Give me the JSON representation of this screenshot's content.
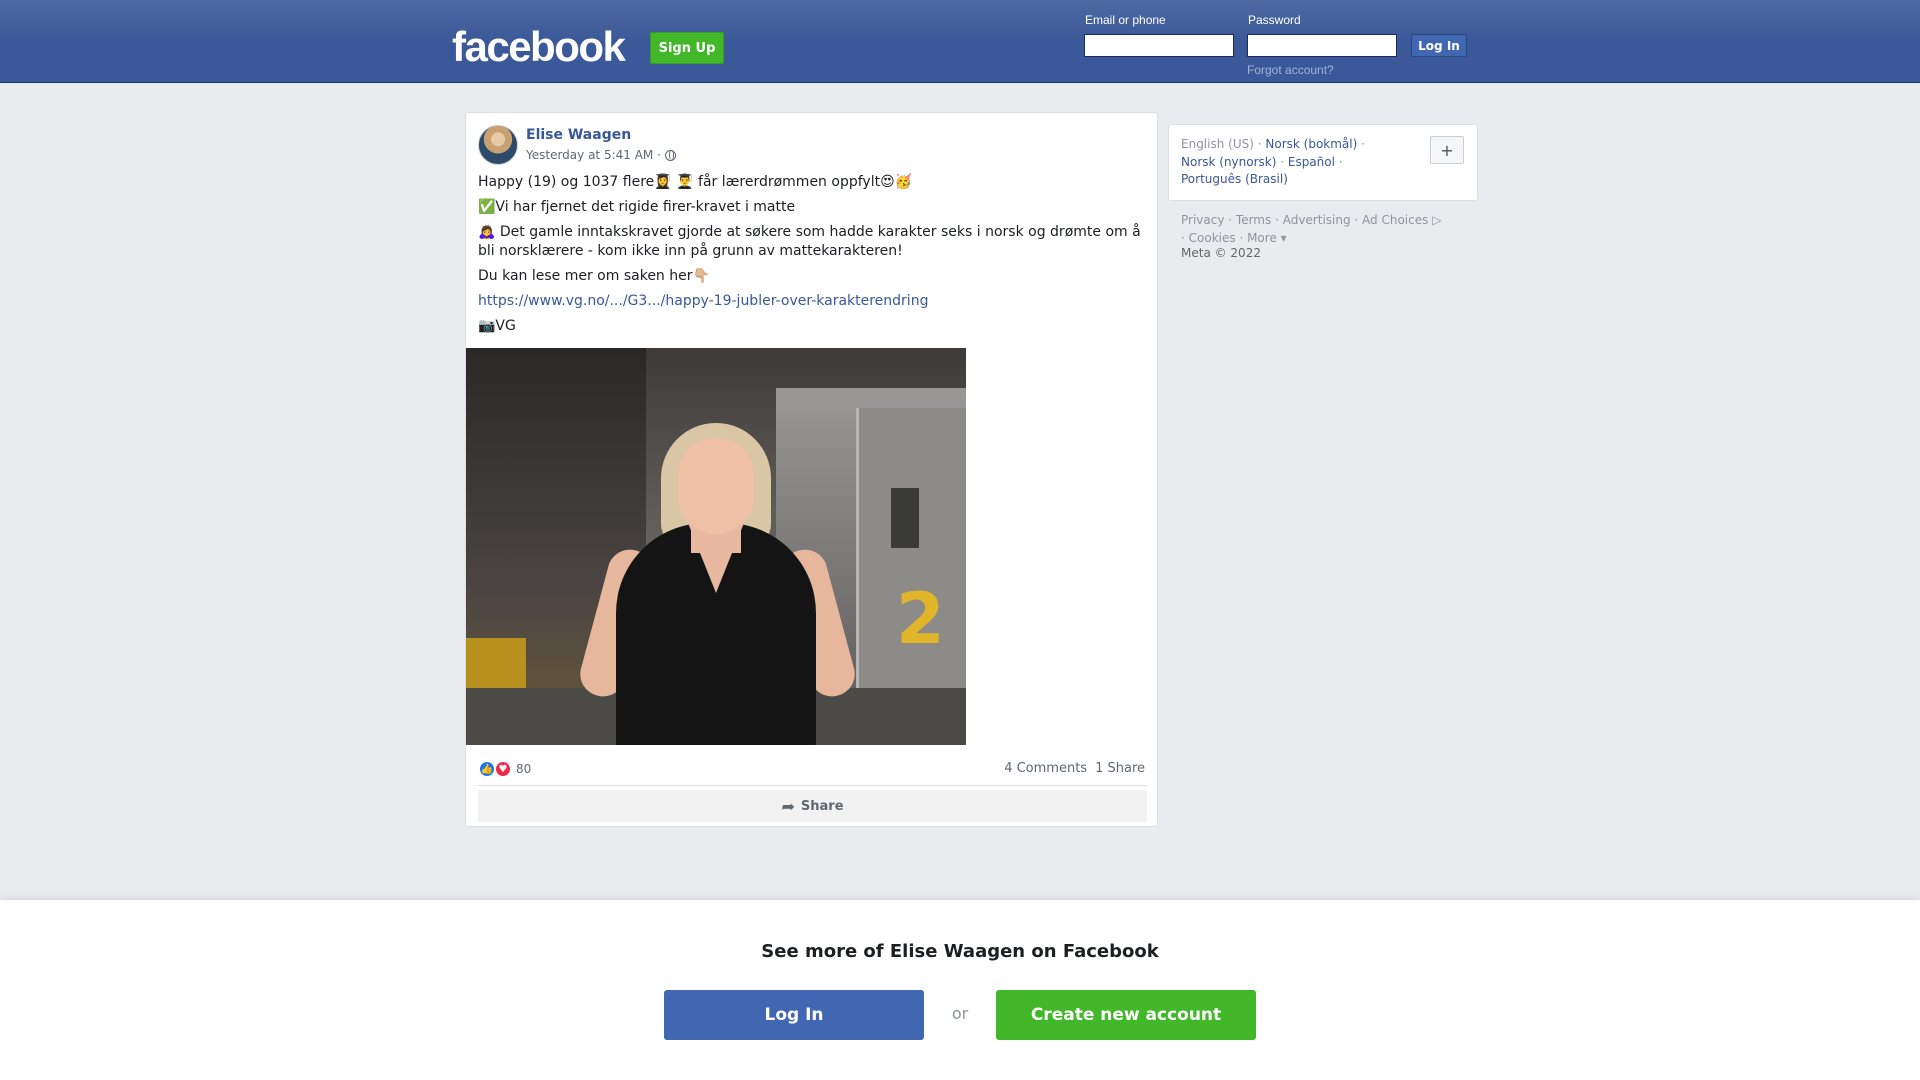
{
  "header": {
    "logo": "facebook",
    "signup_label": "Sign Up",
    "email_label": "Email or phone",
    "password_label": "Password",
    "email_value": "",
    "password_value": "",
    "login_label": "Log In",
    "forgot_label": "Forgot account?"
  },
  "post": {
    "author": "Elise Waagen",
    "timestamp": "Yesterday at 5:41 AM ·",
    "lines": [
      "Happy (19) og 1037 flere👩‍🎓 👨‍🎓 får lærerdrømmen oppfylt😍🥳",
      "✅Vi har fjernet det rigide firer-kravet i matte",
      "🙇‍♀️ Det gamle inntakskravet gjorde at søkere som hadde karakter seks i norsk og drømte om å bli norsklærere - kom ikke inn på grunn av mattekarakteren!",
      "Du kan lese mer om saken her👇🏼",
      "https://www.vg.no/.../G3.../happy-19-jubler-over-karakterendring",
      "📷VG"
    ],
    "photo_number": "2",
    "reaction_count": "80",
    "comments": "4 Comments",
    "shares": "1 Share",
    "share_label": "Share"
  },
  "languages": {
    "current": "English (US)",
    "others": [
      "Norsk (bokmål)",
      "Norsk (nynorsk)",
      "Español",
      "Português (Brasil)"
    ],
    "plus": "+"
  },
  "footer": {
    "links": [
      "Privacy",
      "Terms",
      "Advertising",
      "Ad Choices",
      "Cookies",
      "More"
    ],
    "copyright": "Meta © 2022"
  },
  "banner": {
    "title": "See more of Elise Waagen on Facebook",
    "login_label": "Log In",
    "or": "or",
    "create_label": "Create new account"
  },
  "colors": {
    "brand": "#3b5998",
    "green": "#42b72a",
    "link": "#385898"
  }
}
